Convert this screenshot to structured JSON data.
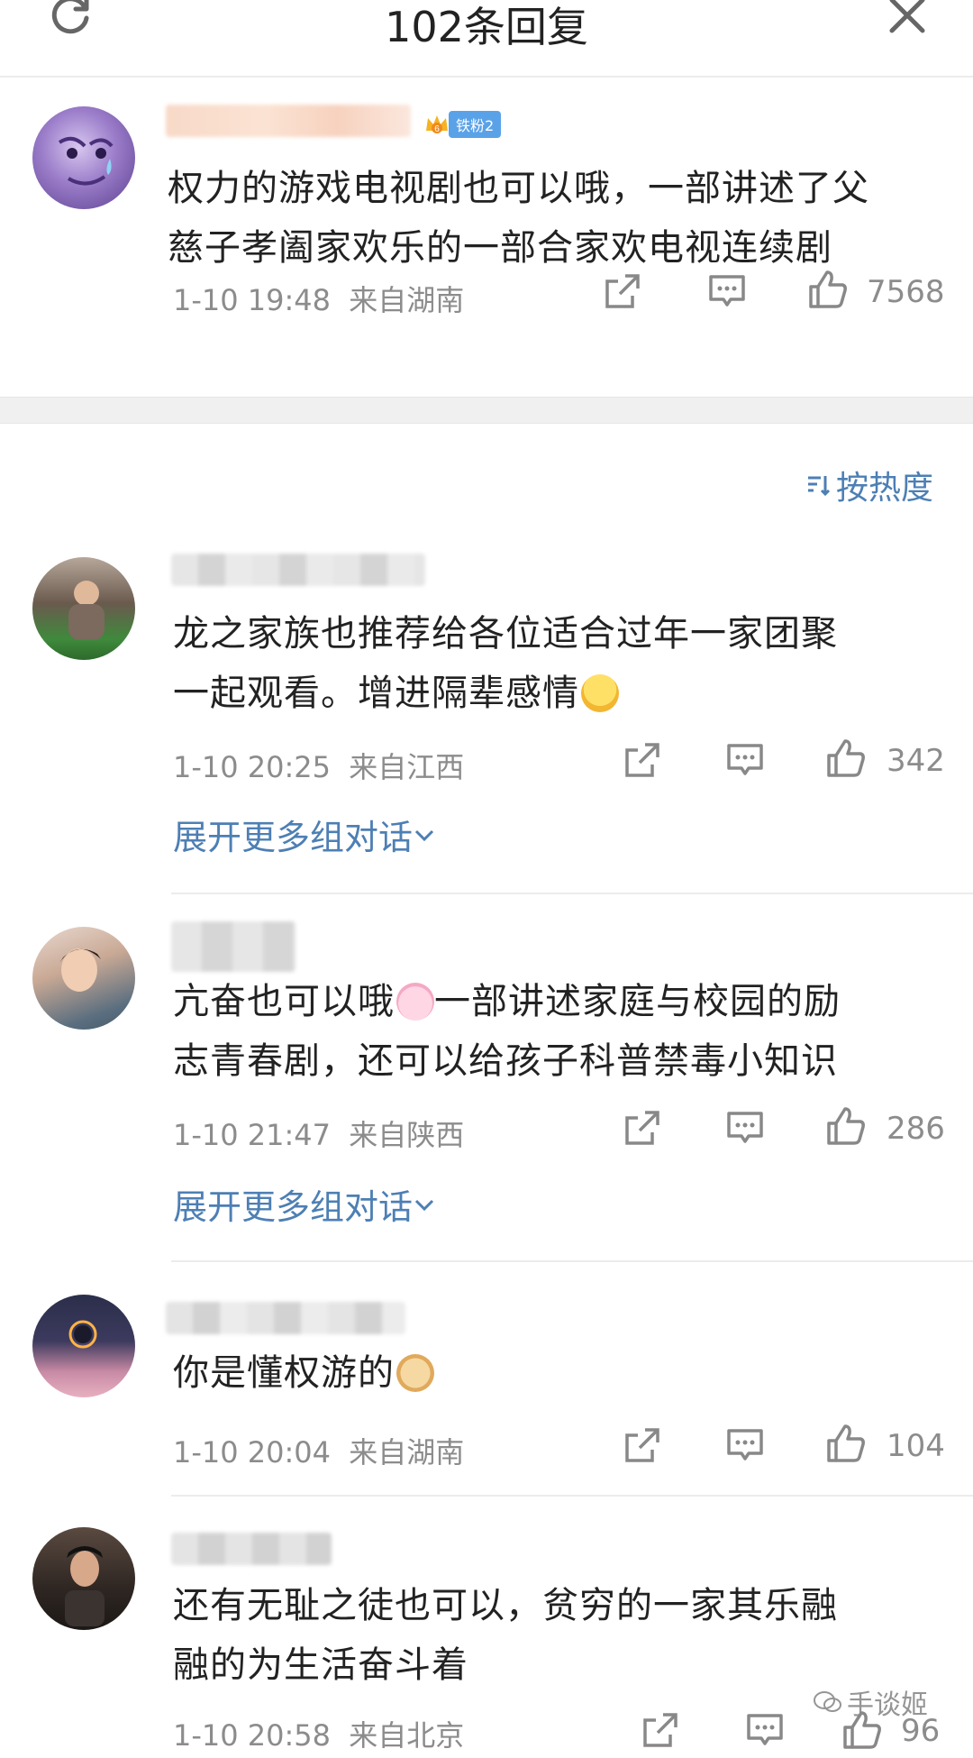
{
  "header": {
    "title": "102条回复"
  },
  "main_post": {
    "badge_label": "铁粉2",
    "text_line1": "权力的游戏电视剧也可以哦，一部讲述了父",
    "text_line2": "慈子孝阖家欢乐的一部合家欢电视连续剧",
    "time": "1-10 19:48",
    "location": "来自湖南",
    "likes": "7568"
  },
  "sort": {
    "label": "按热度"
  },
  "replies": [
    {
      "line1": "龙之家族也推荐给各位适合过年一家团聚",
      "line2": "一起观看。增进隔辈感情",
      "time": "1-10 20:25",
      "location": "来自江西",
      "likes": "342",
      "expand": "展开更多组对话"
    },
    {
      "line1": "亢奋也可以哦",
      "line1b": "一部讲述家庭与校园的励",
      "line2": "志青春剧，还可以给孩子科普禁毒小知识",
      "time": "1-10 21:47",
      "location": "来自陕西",
      "likes": "286",
      "expand": "展开更多组对话"
    },
    {
      "line1": "你是懂权游的",
      "time": "1-10 20:04",
      "location": "来自湖南",
      "likes": "104"
    },
    {
      "line1": "还有无耻之徒也可以，贫穷的一家其乐融",
      "line2": "融的为生活奋斗着",
      "time": "1-10 20:58",
      "location": "来自北京",
      "likes": "96"
    }
  ],
  "watermark": "手谈姬",
  "colors": {
    "link": "#4d7fb4",
    "meta": "#8c8c8c",
    "badge": "#5aa2e8"
  }
}
